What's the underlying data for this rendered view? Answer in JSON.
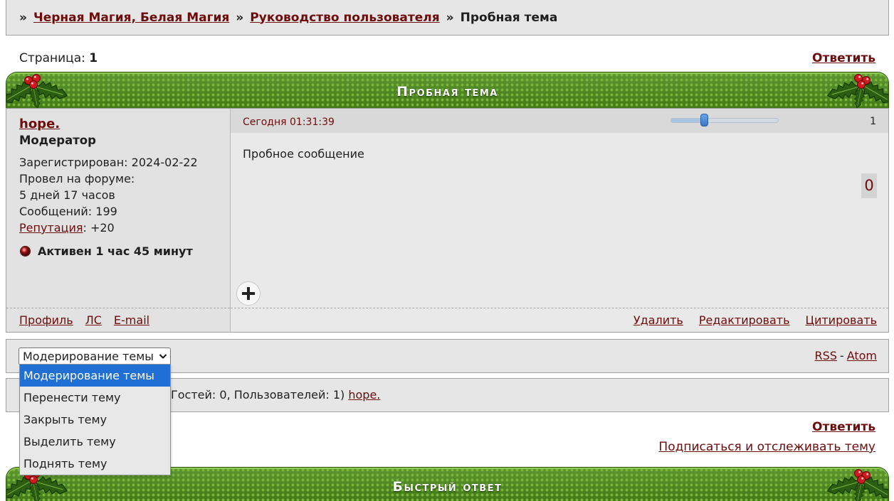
{
  "colors": {
    "link": "#6e0b0b",
    "header_green": "#4b8b1a",
    "option_highlight": "#1f6fd4",
    "activity_dot": "#9c1416"
  },
  "icons": {
    "decoration": "holly-icon",
    "activity": "status-dot-icon",
    "add": "plus-icon",
    "select_arrow": "chevron-down-icon"
  },
  "breadcrumb": {
    "separator": "»",
    "forum": "Черная Магия, Белая Магия",
    "section": "Руководство пользователя",
    "current": "Пробная тема"
  },
  "pagination": {
    "label": "Страница:",
    "current": "1"
  },
  "reply_label": "Ответить",
  "topic": {
    "title": "Пробная тема"
  },
  "post": {
    "author": "hope.",
    "role": "Модератор",
    "registered": "Зарегистрирован: 2024-02-22",
    "time_on_forum_label": "Провел на форуме:",
    "time_on_forum": "5 дней 17 часов",
    "messages": "Сообщений: 199",
    "reputation_label": "Репутация",
    "reputation_value": ": +20",
    "activity": "Активен 1 час 45 минут",
    "profile_links": [
      "Профиль",
      "ЛС",
      "E-mail"
    ],
    "date": "Сегодня 01:31:39",
    "number": "1",
    "slider_level": 0.31,
    "body": "Пробное сообщение",
    "rating": "0",
    "actions": [
      "Удалить",
      "Редактировать",
      "Цитировать"
    ]
  },
  "moderation": {
    "selected": "Модерирование темы",
    "options": [
      "Модерирование темы",
      "Перенести тему",
      "Закрыть тему",
      "Выделить тему",
      "Поднять тему"
    ],
    "highlighted_index": 0,
    "feeds": {
      "rss": "RSS",
      "separator": "-",
      "atom": "Atom"
    }
  },
  "online": {
    "text": "Гостей: 0, Пользователей: 1)",
    "user": "hope."
  },
  "footer_actions": {
    "reply": "Ответить",
    "subscribe": "Подписаться и отслеживать тему"
  },
  "quick_reply": {
    "title": "Быстрый ответ"
  }
}
